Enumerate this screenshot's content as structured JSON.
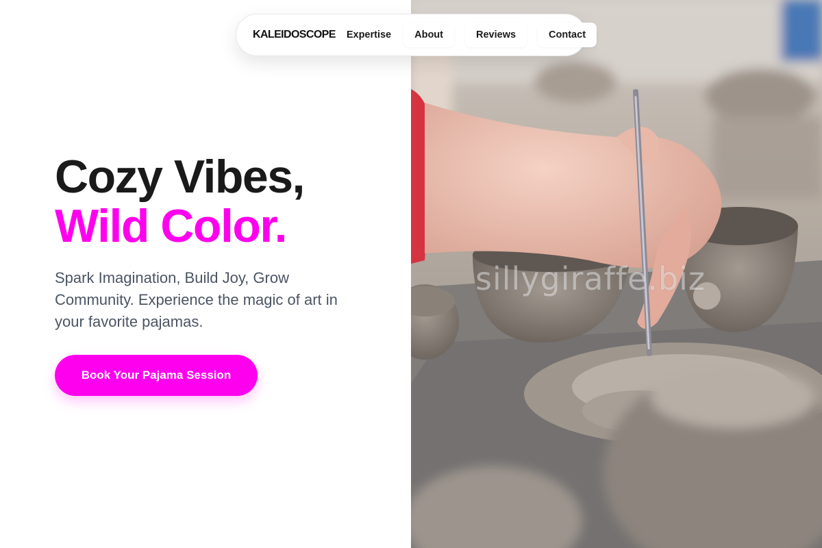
{
  "nav": {
    "brand": "KALEIDOSCOPE",
    "links": [
      {
        "label": "Expertise"
      },
      {
        "label": "About"
      },
      {
        "label": "Reviews"
      },
      {
        "label": "Contact"
      }
    ]
  },
  "hero": {
    "title_line1": "Cozy Vibes,",
    "title_line2": "Wild Color.",
    "subtitle": "Spark Imagination, Build Joy, Grow Community. Experience the magic of art in your favorite pajamas.",
    "cta_label": "Book Your Pajama Session"
  },
  "photo": {
    "watermark": "sillygiraffe.biz",
    "alt": "Hand carving a clay pottery piece with a needle tool"
  },
  "colors": {
    "accent": "#ff00ee",
    "heading": "#1a1a1a",
    "body_text": "#4b5563"
  }
}
